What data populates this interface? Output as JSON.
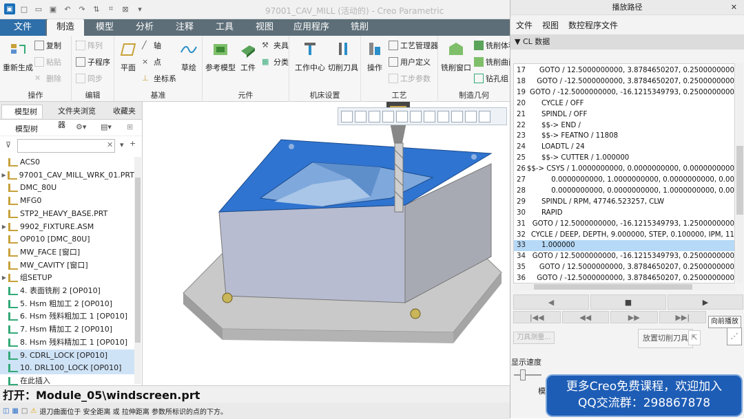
{
  "window": {
    "title": "97001_CAV_MILL (活动的) - Creo Parametric"
  },
  "ribbon_tabs": [
    "文件",
    "制造",
    "模型",
    "分析",
    "注释",
    "工具",
    "视图",
    "应用程序",
    "铣削"
  ],
  "ribbon": {
    "op_regen": "重新生成",
    "op_copy": "复制",
    "op_paste": "粘贴",
    "op_delete": "删除",
    "ed_pattern": "阵列",
    "ed_subprog": "子程序",
    "ed_sync": "同步",
    "ref_plane": "平面",
    "ref_axis": "轴",
    "ref_point": "点",
    "ref_csys": "坐标系",
    "ref_sketch": "草绘",
    "comp_refmodel": "参考模型",
    "comp_workpiece": "工件",
    "comp_fixture": "夹具",
    "comp_classify": "分类",
    "mach_center": "工作中心",
    "mach_cutter": "切削刀具",
    "proc_operation": "操作",
    "proc_manager": "工艺管理器",
    "proc_userdef": "用户定义",
    "proc_stepparam": "工步参数",
    "mill_window": "铣削窗口",
    "mill_volume": "铣削体积块",
    "mill_curve": "铣削曲面",
    "mill_drillgroup": "钻孔组",
    "groups": [
      "操作",
      "编辑",
      "基准",
      "元件",
      "机床设置",
      "工艺",
      "制造几何"
    ]
  },
  "left_panel": {
    "tabs": [
      "模型树",
      "文件夹浏览器",
      "收藏夹"
    ],
    "tree_label": "模型树",
    "items": [
      "ACS0",
      "97001_CAV_MILL_WRK_01.PRT",
      "DMC_80U",
      "MFG0",
      "STP2_HEAVY_BASE.PRT",
      "9902_FIXTURE.ASM",
      "OP010 [DMC_80U]",
      "MW_FACE [窗口]",
      "MW_CAVITY [窗口]",
      "组SETUP",
      "4. 表面铣削 2 [OP010]",
      "5. Hsm 粗加工 2 [OP010]",
      "6. Hsm 残料粗加工 1 [OP010]",
      "7. Hsm 精加工 2 [OP010]",
      "8. Hsm 残料精加工 1 [OP010]",
      "9. CDRL_LOCK [OP010]",
      "10. DRL100_LOCK [OP010]",
      "在此插入"
    ]
  },
  "status": {
    "open_msg": "打开：Module_05\\windscreen.prt",
    "message": "退刀曲面位于 安全距离 或 拉伸距离 参数所标识的点的下方。"
  },
  "right_panel": {
    "title": "播放路径",
    "menu": [
      "文件",
      "视图",
      "数控程序文件"
    ],
    "cl_header": "CL 数据",
    "cl_rows": [
      {
        "n": "17",
        "t": "GOTO / 12.5000000000, 3.8784650207, 0.2500000000"
      },
      {
        "n": "18",
        "t": "GOTO / -12.5000000000, 3.8784650207, 0.2500000000"
      },
      {
        "n": "19",
        "t": "GOTO / -12.5000000000, -16.1215349793, 0.2500000000"
      },
      {
        "n": "20",
        "t": "CYCLE / OFF"
      },
      {
        "n": "21",
        "t": "SPINDL / OFF"
      },
      {
        "n": "22",
        "t": "$$-> END /"
      },
      {
        "n": "23",
        "t": "$$-> FEATNO / 11808"
      },
      {
        "n": "24",
        "t": "LOADTL / 24"
      },
      {
        "n": "25",
        "t": "$$-> CUTTER / 1.000000"
      },
      {
        "n": "26",
        "t": "$$-> CSYS / 1.0000000000, 0.0000000000, 0.0000000000"
      },
      {
        "n": "27",
        "t": "0.0000000000, 1.0000000000, 0.0000000000, 0.00"
      },
      {
        "n": "28",
        "t": "0.0000000000, 0.0000000000, 1.0000000000, 0.00"
      },
      {
        "n": "29",
        "t": "SPINDL / RPM, 47746.523257,  CLW"
      },
      {
        "n": "30",
        "t": "RAPID"
      },
      {
        "n": "31",
        "t": "GOTO / 12.5000000000, -16.1215349793, 1.2500000000"
      },
      {
        "n": "32",
        "t": "CYCLE / DEEP, DEPTH, 9.000000, STEP, 0.100000, IPM, 11"
      },
      {
        "n": "33",
        "t": "1.000000"
      },
      {
        "n": "34",
        "t": "GOTO / 12.5000000000, -16.1215349793, 0.2500000000"
      },
      {
        "n": "35",
        "t": "GOTO / 12.5000000000, 3.8784650207, 0.2500000000"
      },
      {
        "n": "36",
        "t": "GOTO / -12.5000000000, 3.8784650207, 0.2500000000"
      }
    ],
    "highlighted_row": "33",
    "tooltip": "向前播放",
    "measure_btn": "刀具测量...",
    "place_cutter": "放置切削刀具",
    "speed_label": "显示速度",
    "speed_extra": "模"
  },
  "promo": {
    "line1": "更多Creo免费课程，欢迎加入",
    "line2": "QQ交流群：298867878"
  }
}
